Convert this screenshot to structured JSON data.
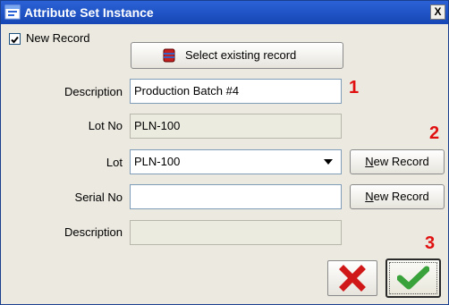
{
  "window": {
    "title": "Attribute Set Instance",
    "close_label": "X"
  },
  "new_record_checkbox": {
    "label": "New Record",
    "checked": true
  },
  "select_existing_button": {
    "label": "Select existing record"
  },
  "form": {
    "description": {
      "label": "Description",
      "value": "Production Batch #4"
    },
    "lot_no": {
      "label": "Lot No",
      "value": "PLN-100"
    },
    "lot": {
      "label": "Lot",
      "value": "PLN-100",
      "button": "New Record"
    },
    "serial_no": {
      "label": "Serial No",
      "value": "",
      "button": "New Record"
    },
    "description2": {
      "label": "Description",
      "value": ""
    }
  },
  "markers": {
    "m1": "1",
    "m2": "2",
    "m3": "3"
  },
  "colors": {
    "title_bar": "#1646b5",
    "marker": "#e01010",
    "ok_green": "#3aa23a",
    "cancel_red": "#d01818"
  }
}
